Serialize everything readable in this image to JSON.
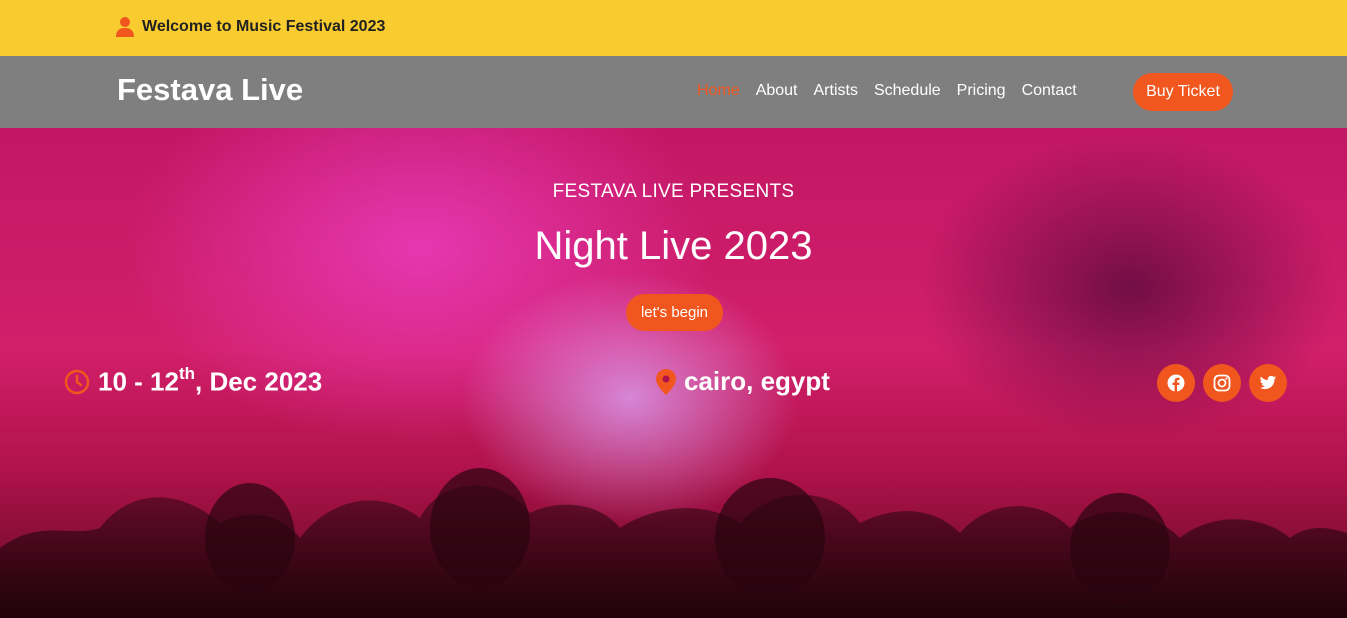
{
  "topbar": {
    "welcome": "Welcome to Music Festival 2023",
    "icon": "user-icon"
  },
  "navbar": {
    "brand": "Festava Live",
    "links": [
      "Home",
      "About",
      "Artists",
      "Schedule",
      "Pricing",
      "Contact"
    ],
    "active": "Home",
    "buy_ticket": "Buy Ticket"
  },
  "hero": {
    "subtitle": "FESTAVA LIVE PRESENTS",
    "title": "Night Live 2023",
    "cta": "let's begin",
    "date_prefix": "10 - 12",
    "date_sup": "th",
    "date_suffix": ", Dec 2023",
    "location": "cairo, egypt",
    "social": [
      "facebook-icon",
      "instagram-icon",
      "twitter-icon"
    ]
  },
  "colors": {
    "accent": "#f0561d",
    "topbar": "#f8cb2e",
    "navbar": "#7f7f7f"
  }
}
